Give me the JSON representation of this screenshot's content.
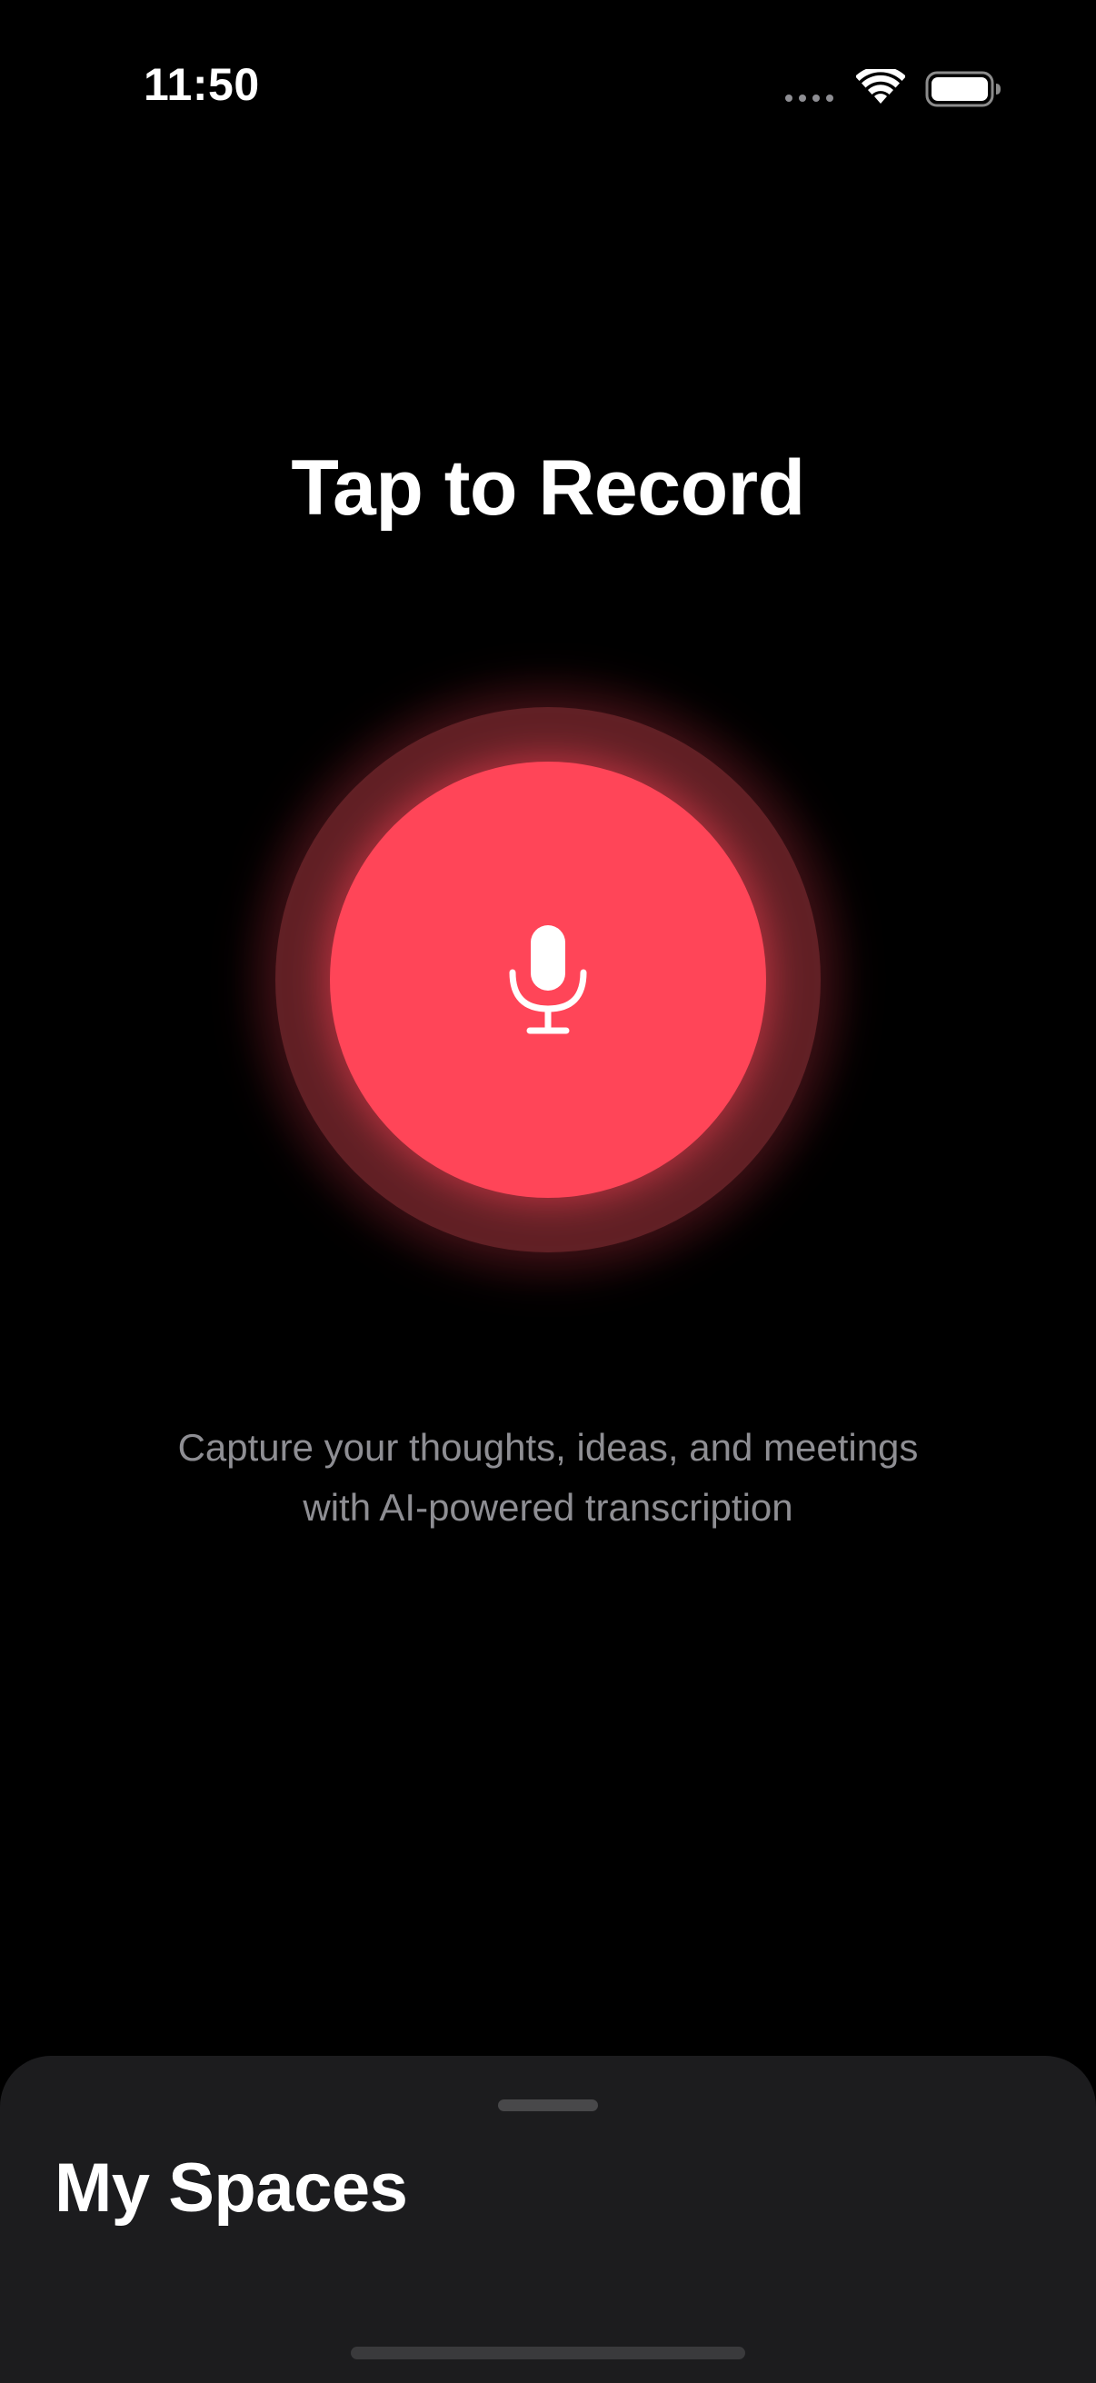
{
  "status_bar": {
    "time": "11:50",
    "icons": [
      "signal-dots-icon",
      "wifi-icon",
      "battery-icon"
    ]
  },
  "main": {
    "title": "Tap to Record",
    "record_button_icon": "microphone-icon",
    "subtitle_line1": "Capture your thoughts, ideas, and meetings",
    "subtitle_line2": "with AI-powered transcription"
  },
  "sheet": {
    "title": "My Spaces"
  },
  "colors": {
    "accent": "#ff4558",
    "background": "#000000",
    "sheet_background": "#1c1c1e",
    "secondary_text": "#8e8e93"
  }
}
